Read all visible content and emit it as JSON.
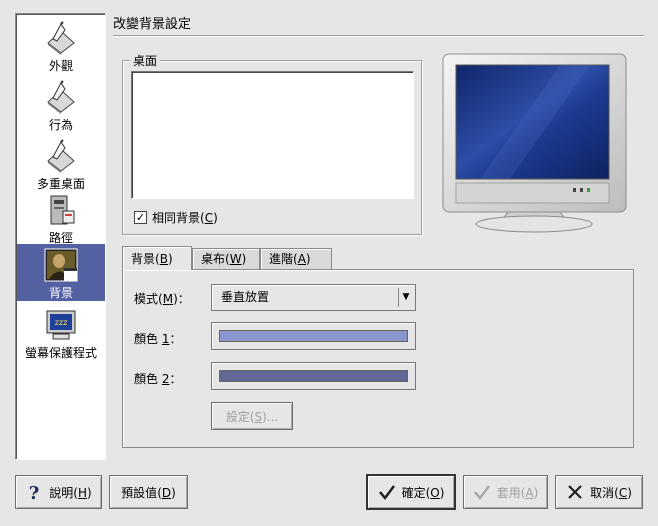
{
  "sidebar": {
    "items": [
      {
        "label": "外觀",
        "icon": "appearance-icon"
      },
      {
        "label": "行為",
        "icon": "behavior-icon"
      },
      {
        "label": "路徑",
        "icon": "paths-icon"
      },
      {
        "label": "多重桌面",
        "icon": "multiple-desktops-icon"
      },
      {
        "label": "背景",
        "icon": "background-icon",
        "selected": true
      },
      {
        "label": "螢幕保護程式",
        "icon": "screensaver-icon"
      }
    ]
  },
  "title": "改變背景設定",
  "desktop": {
    "legend": "桌面",
    "same_bg_label": "相同背景",
    "same_bg_key": "C",
    "same_bg_checked": true
  },
  "tabs": [
    {
      "label": "背景",
      "key": "B",
      "active": true
    },
    {
      "label": "桌布",
      "key": "W",
      "active": false
    },
    {
      "label": "進階",
      "key": "A",
      "active": false
    }
  ],
  "background": {
    "mode_label": "模式",
    "mode_key": "M",
    "mode_value": "垂直放置",
    "color1_label": "顏色",
    "color1_key": "1",
    "color1": "#8a95cc",
    "color2_label": "顏色",
    "color2_key": "2",
    "color2": "#5f6796",
    "settings_label": "設定",
    "settings_key": "S",
    "settings_suffix": "..."
  },
  "buttons": {
    "help": {
      "label": "說明",
      "key": "H"
    },
    "defaults": {
      "label": "預設值",
      "key": "D"
    },
    "ok": {
      "label": "確定",
      "key": "O"
    },
    "apply": {
      "label": "套用",
      "key": "A"
    },
    "cancel": {
      "label": "取消",
      "key": "C"
    }
  },
  "colors": {
    "selection": "#5361a3",
    "monitor_screen": "#1c3a8c"
  }
}
